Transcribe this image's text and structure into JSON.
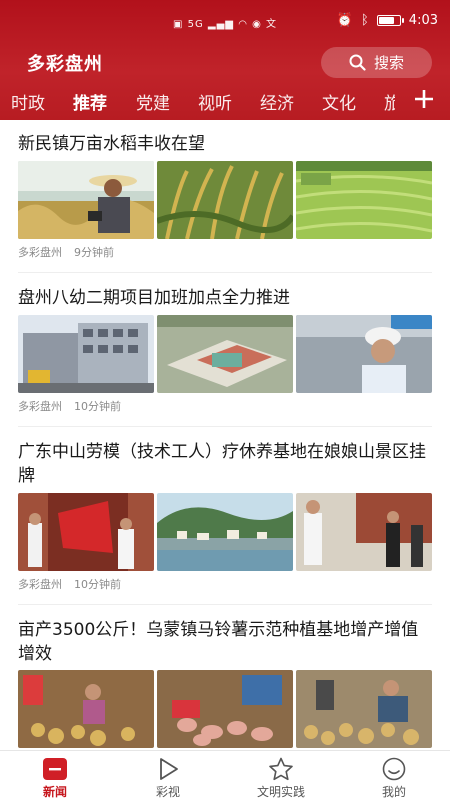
{
  "status_bar": {
    "network": "5G",
    "time": "4:03"
  },
  "header": {
    "title": "多彩盘州",
    "search_label": "搜索",
    "brand_color": "#c0232a"
  },
  "tabs": [
    {
      "label": "时政",
      "active": false
    },
    {
      "label": "推荐",
      "active": true
    },
    {
      "label": "党建",
      "active": false
    },
    {
      "label": "视听",
      "active": false
    },
    {
      "label": "经济",
      "active": false
    },
    {
      "label": "文化",
      "active": false
    },
    {
      "label": "旅",
      "active": false
    }
  ],
  "articles": [
    {
      "title": "新民镇万亩水稻丰收在望",
      "source": "多彩盘州",
      "time": "9分钟前"
    },
    {
      "title": "盘州八幼二期项目加班加点全力推进",
      "source": "多彩盘州",
      "time": "10分钟前"
    },
    {
      "title": "广东中山劳模（技术工人）疗休养基地在娘娘山景区挂牌",
      "source": "多彩盘州",
      "time": "10分钟前"
    },
    {
      "title": "亩产3500公斤！乌蒙镇马铃薯示范种植基地增产增值增效",
      "source": "",
      "time": ""
    }
  ],
  "bottom_nav": [
    {
      "label": "新闻",
      "icon": "news-icon",
      "active": true
    },
    {
      "label": "彩视",
      "icon": "play-icon",
      "active": false
    },
    {
      "label": "文明实践",
      "icon": "star-icon",
      "active": false
    },
    {
      "label": "我的",
      "icon": "smile-icon",
      "active": false
    }
  ]
}
